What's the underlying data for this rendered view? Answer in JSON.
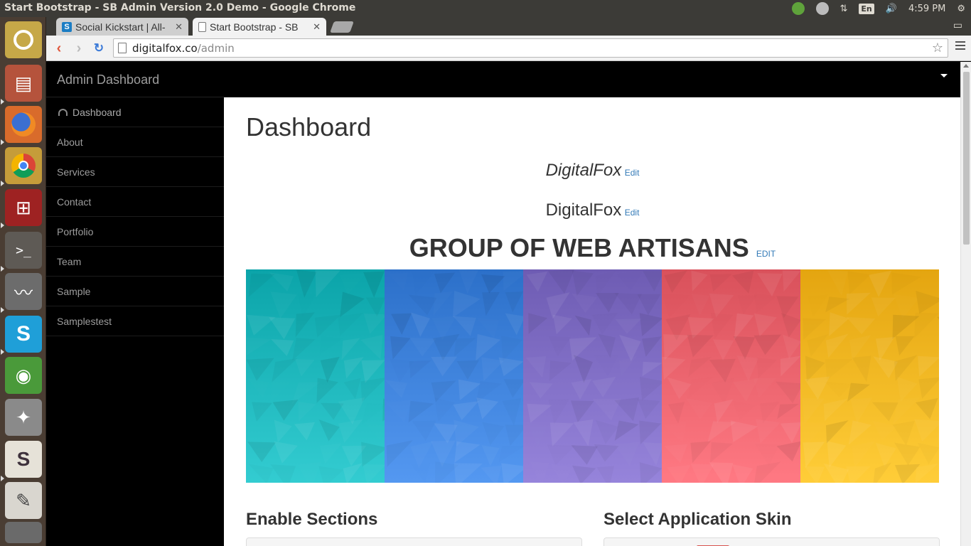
{
  "os": {
    "window_title": "Start Bootstrap - SB Admin Version 2.0 Demo - Google Chrome",
    "keyboard": "En",
    "clock": "4:59 PM"
  },
  "browser": {
    "tabs": [
      {
        "label": "Social Kickstart | All-",
        "favicon": "S",
        "active": false
      },
      {
        "label": "Start Bootstrap - SB",
        "favicon": "",
        "active": true
      }
    ],
    "address": {
      "host": "digitalfox.co",
      "path": "/admin"
    }
  },
  "app": {
    "brand": "Admin Dashboard",
    "sidebar": [
      {
        "label": "Dashboard",
        "icon": "dashboard-icon"
      },
      {
        "label": "About"
      },
      {
        "label": "Services"
      },
      {
        "label": "Contact"
      },
      {
        "label": "Portfolio"
      },
      {
        "label": "Team"
      },
      {
        "label": "Sample"
      },
      {
        "label": "Samplestest"
      }
    ],
    "main": {
      "title": "Dashboard",
      "site_title_italic": "DigitalFox",
      "site_name": "DigitalFox",
      "tagline": "GROUP OF WEB ARTISANS",
      "edit_label": "Edit",
      "edit_upper": "EDIT",
      "section_left": "Enable Sections",
      "section_right": "Select Application Skin"
    }
  },
  "colors": {
    "hero": [
      "#1ab3b8",
      "#3b7fd8",
      "#7d6bc2",
      "#e8606a",
      "#f3b41f"
    ],
    "link": "#337ab7"
  }
}
